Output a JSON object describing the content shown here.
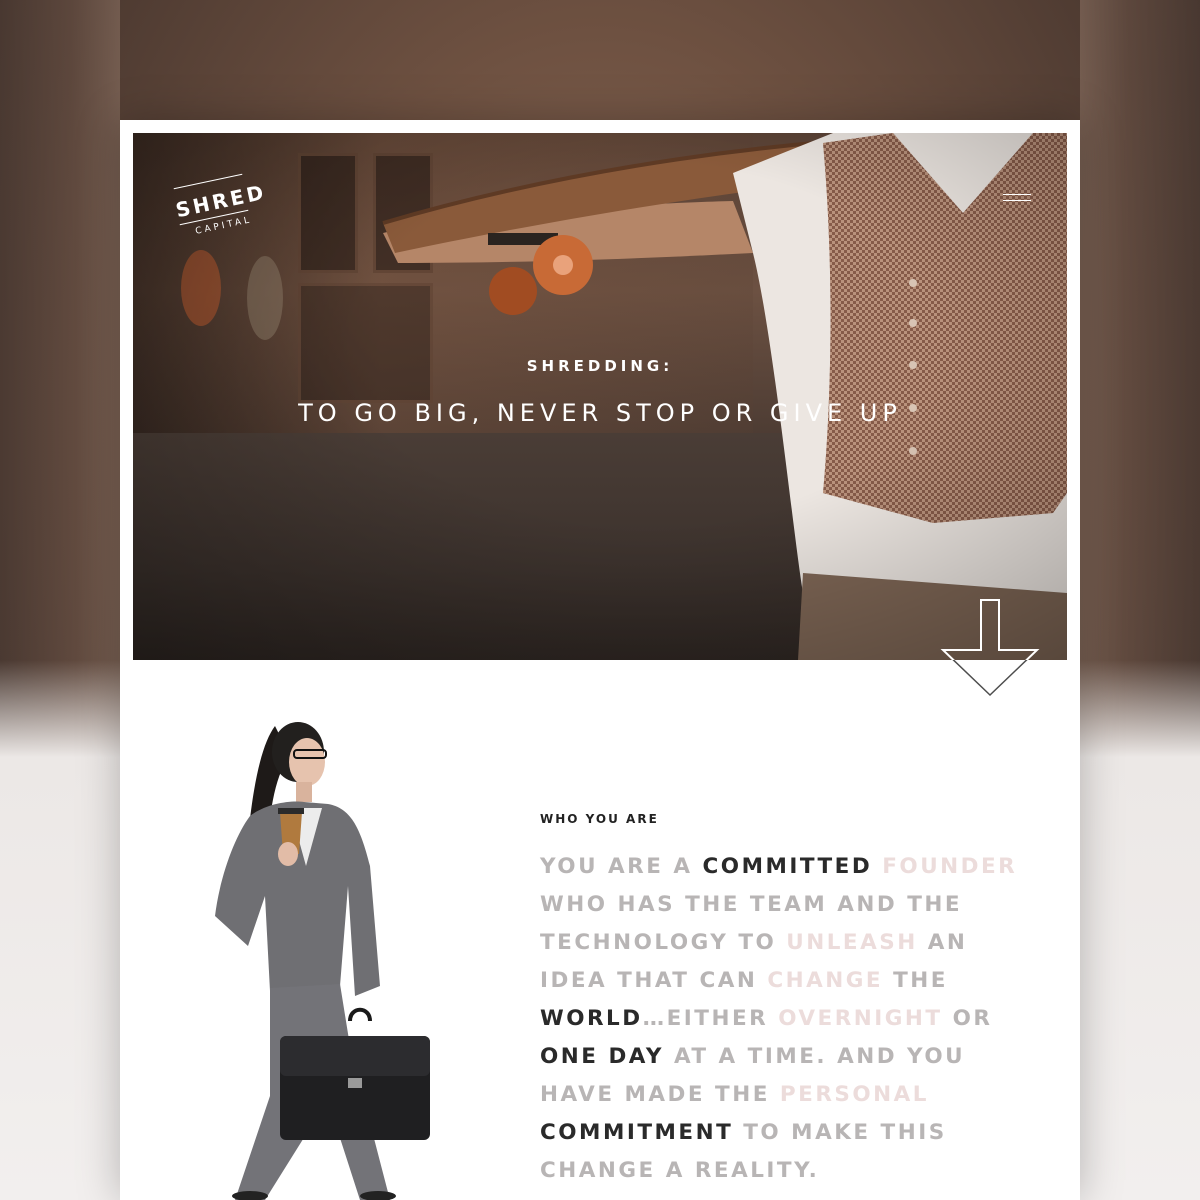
{
  "brand": {
    "logo_main": "SHRED",
    "logo_sub": "CAPITAL"
  },
  "nav": {
    "menu_icon": "hamburger-icon"
  },
  "hero": {
    "kicker": "SHREDDING:",
    "title": "TO GO BIG, NEVER STOP OR GIVE UP",
    "scroll_icon": "arrow-down-icon"
  },
  "about": {
    "label": "WHO YOU ARE",
    "segments": [
      {
        "text": "YOU ARE A ",
        "style": "gray"
      },
      {
        "text": "COMMITTED",
        "style": "dark"
      },
      {
        "text": " ",
        "style": "gray"
      },
      {
        "text": "FOUNDER",
        "style": "pink"
      },
      {
        "text": " WHO HAS THE TEAM AND THE TECHNOLOGY TO ",
        "style": "gray"
      },
      {
        "text": "UNLEASH",
        "style": "pink"
      },
      {
        "text": " AN IDEA THAT CAN ",
        "style": "gray"
      },
      {
        "text": "CHANGE",
        "style": "pink"
      },
      {
        "text": " THE ",
        "style": "gray"
      },
      {
        "text": "WORLD",
        "style": "dark"
      },
      {
        "text": "…EITHER ",
        "style": "gray"
      },
      {
        "text": "OVERNIGHT",
        "style": "pink"
      },
      {
        "text": " OR ",
        "style": "gray"
      },
      {
        "text": "ONE DAY",
        "style": "dark"
      },
      {
        "text": " AT A TIME. AND YOU HAVE MADE THE ",
        "style": "gray"
      },
      {
        "text": "PERSONAL",
        "style": "pink"
      },
      {
        "text": " ",
        "style": "gray"
      },
      {
        "text": "COMMITMENT",
        "style": "dark"
      },
      {
        "text": " TO MAKE THIS CHANGE A REALITY.",
        "style": "gray"
      }
    ]
  },
  "colors": {
    "dark_text": "#2a2a2a",
    "gray_text": "#b8b5b5",
    "pink_text": "#ecdcdb",
    "card_bg": "#ffffff"
  }
}
